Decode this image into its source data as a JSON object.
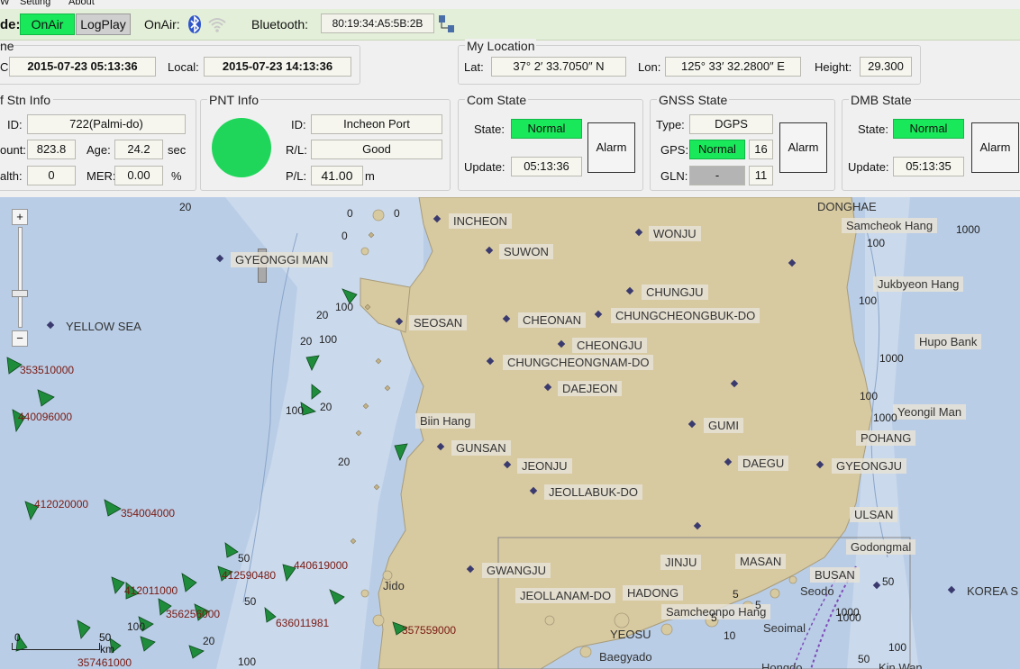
{
  "menu": {
    "items": [
      "W",
      "Setting",
      "About"
    ]
  },
  "toolbar": {
    "mode_label": "de:",
    "onair_label": "OnAir",
    "logplay_label": "LogPlay",
    "onair_status_label": "OnAir:",
    "bluetooth_label": "Bluetooth:",
    "bluetooth_address": "80:19:34:A5:5B:2B"
  },
  "time": {
    "title": "ne",
    "utc_label": "C:",
    "utc_value": "2015-07-23 05:13:36",
    "local_label": "Local:",
    "local_value": "2015-07-23 14:13:36"
  },
  "location": {
    "title": "My Location",
    "lat_label": "Lat:",
    "lat_value": "37° 2′ 33.7050″ N",
    "lon_label": "Lon:",
    "lon_value": "125° 33′ 32.2800″ E",
    "height_label": "Height:",
    "height_value": "29.300"
  },
  "stn": {
    "title": "f Stn Info",
    "id_label": "ID:",
    "id_value": "722(Palmi-do)",
    "count_label": "ount:",
    "count_value": "823.8",
    "age_label": "Age:",
    "age_value": "24.2",
    "age_unit": "sec",
    "health_label": "alth:",
    "health_value": "0",
    "mer_label": "MER:",
    "mer_value": "0.00",
    "mer_unit": "%"
  },
  "pnt": {
    "title": "PNT Info",
    "id_label": "ID:",
    "id_value": "Incheon Port",
    "rl_label": "R/L:",
    "rl_value": "Good",
    "pl_label": "P/L:",
    "pl_value": "41.00",
    "pl_unit": "m",
    "indicator_color": "#1fd65a"
  },
  "com": {
    "title": "Com State",
    "state_label": "State:",
    "state_value": "Normal",
    "update_label": "Update:",
    "update_value": "05:13:36",
    "alarm_label": "Alarm"
  },
  "gnss": {
    "title": "GNSS State",
    "type_label": "Type:",
    "type_value": "DGPS",
    "gps_label": "GPS:",
    "gps_value": "Normal",
    "gps_count": "16",
    "gln_label": "GLN:",
    "gln_value": "-",
    "gln_count": "11",
    "alarm_label": "Alarm"
  },
  "dmb": {
    "title": "DMB State",
    "state_label": "State:",
    "state_value": "Normal",
    "update_label": "Update:",
    "update_value": "05:13:35",
    "alarm_label": "Alarm"
  },
  "map": {
    "zoom_in": "+",
    "zoom_out": "−",
    "scale_zero": "0",
    "scale_fifty": "50",
    "scale_unit": "km",
    "places": [
      "INCHEON",
      "SUWON",
      "WONJU",
      "GYEONGGI MAN",
      "CHUNGJU",
      "SEOSAN",
      "CHEONAN",
      "CHUNGCHEONGBUK-DO",
      "CHEONGJU",
      "CHUNGCHEONGNAM-DO",
      "DAEJEON",
      "GUMI",
      "Biin Hang",
      "GUNSAN",
      "JEONJU",
      "DAEGU",
      "GYEONGJU",
      "JEOLLABUK-DO",
      "YELLOW SEA",
      "DONGHAE",
      "Samcheok Hang",
      "Jukbyeon Hang",
      "Hupo Bank",
      "Yeongil Man",
      "POHANG",
      "ULSAN",
      "Godongmal",
      "GWANGJU",
      "JINJU",
      "MASAN",
      "BUSAN",
      "Seodo",
      "JEOLLANAM-DO",
      "HADONG",
      "Samcheonpo Hang",
      "Seoimal",
      "YEOSU",
      "Baegyado",
      "Jido",
      "KOREA S",
      "Hongdo",
      "Kin Wan"
    ],
    "targets": [
      "353510000",
      "440096000",
      "412020000",
      "354004000",
      "412011000",
      "412590480",
      "440619000",
      "356256000",
      "636011981",
      "357559000",
      "357461000"
    ],
    "depths": [
      "20",
      "100",
      "20",
      "100",
      "20",
      "20",
      "100",
      "50",
      "50",
      "100",
      "20",
      "100",
      "1000",
      "100",
      "1000",
      "100",
      "1000",
      "1000",
      "50",
      "100",
      "20",
      "5",
      "5",
      "0",
      "0",
      "0",
      "1000",
      "100",
      "5",
      "10",
      "50"
    ]
  }
}
